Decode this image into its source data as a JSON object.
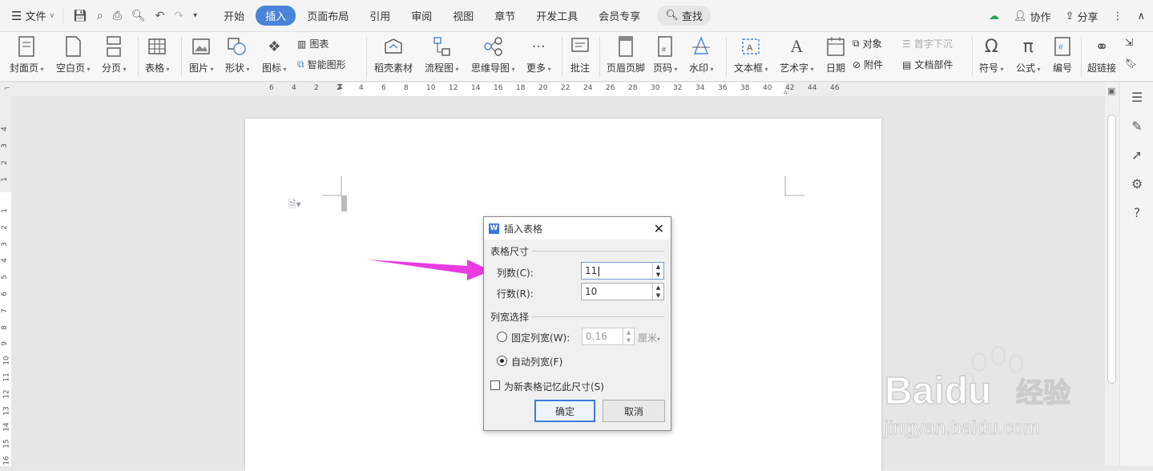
{
  "topbar": {
    "file_label": "文件",
    "tabs": [
      "开始",
      "插入",
      "页面布局",
      "引用",
      "审阅",
      "视图",
      "章节",
      "开发工具",
      "会员专享"
    ],
    "active_tab": "插入",
    "search_label": "查找",
    "collab_label": "协作",
    "share_label": "分享"
  },
  "ribbon": {
    "cover_page": "封面页",
    "blank_page": "空白页",
    "page_break": "分页",
    "table": "表格",
    "picture": "图片",
    "shape": "形状",
    "icon": "图标",
    "chart": "图表",
    "smart_art": "智能图形",
    "docer_material": "稻壳素材",
    "flowchart": "流程图",
    "mindmap": "思维导图",
    "more": "更多",
    "comment": "批注",
    "header_footer": "页眉页脚",
    "page_number": "页码",
    "watermark": "水印",
    "textbox": "文本框",
    "wordart": "艺术字",
    "date": "日期",
    "object": "对象",
    "attachment": "附件",
    "drop_cap": "首字下沉",
    "doc_parts": "文档部件",
    "symbol": "符号",
    "formula": "公式",
    "numbering": "编号",
    "hyperlink": "超链接"
  },
  "ruler_h_ticks": [
    "6",
    "4",
    "2",
    "2",
    "4",
    "6",
    "8",
    "10",
    "12",
    "14",
    "16",
    "18",
    "20",
    "22",
    "24",
    "26",
    "28",
    "30",
    "32",
    "34",
    "36",
    "38",
    "40",
    "42",
    "44",
    "46"
  ],
  "ruler_v_ticks": [
    "4",
    "3",
    "2",
    "1",
    "1",
    "2",
    "3",
    "4",
    "5",
    "6",
    "7",
    "8",
    "9",
    "10",
    "11",
    "12",
    "13",
    "14",
    "15",
    "16"
  ],
  "dialog": {
    "title": "插入表格",
    "table_size_group": "表格尺寸",
    "columns_label": "列数(C):",
    "columns_value": "11",
    "rows_label": "行数(R):",
    "rows_value": "10",
    "col_width_group": "列宽选择",
    "fixed_width_label": "固定列宽(W):",
    "fixed_width_value": "0.16",
    "fixed_width_unit": "厘米",
    "auto_width_label": "自动列宽(F)",
    "remember_label": "为新表格记忆此尺寸(S)",
    "ok_label": "确定",
    "cancel_label": "取消",
    "selected_option": "auto",
    "remember_checked": false
  },
  "watermark": {
    "brand": "Baidu",
    "cn": "经验",
    "url": "jingyan.baidu.com"
  },
  "colors": {
    "accent": "#4a84d8",
    "arrow": "#e83be0"
  }
}
